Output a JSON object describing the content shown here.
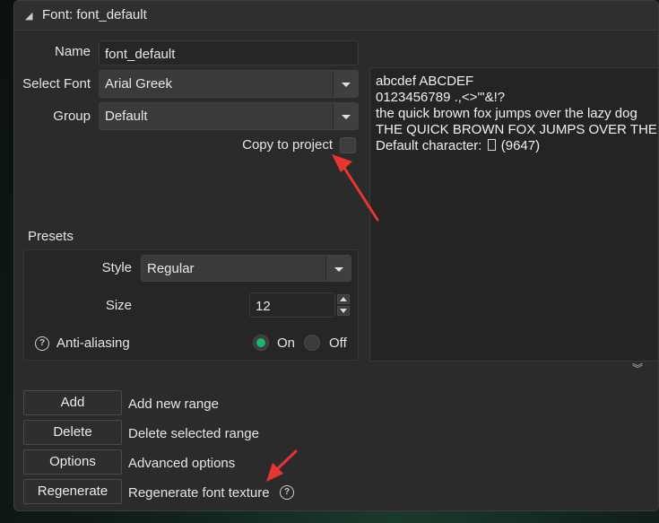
{
  "window": {
    "title": "Font: font_default"
  },
  "form": {
    "name_label": "Name",
    "name_value": "font_default",
    "select_font_label": "Select Font",
    "select_font_value": "Arial Greek",
    "group_label": "Group",
    "group_value": "Default",
    "copy_label": "Copy to project"
  },
  "preview": {
    "lines": [
      "abcdef ABCDEF",
      "0123456789 .,<>\"'&!?",
      "the quick brown fox jumps over the lazy dog",
      "THE QUICK BROWN FOX JUMPS OVER THE LAZY DOG"
    ],
    "default_char_prefix": "Default character:",
    "default_char_code": "(9647)"
  },
  "presets": {
    "title": "Presets",
    "style_label": "Style",
    "style_value": "Regular",
    "size_label": "Size",
    "size_value": "12",
    "antialias_label": "Anti-aliasing",
    "on_label": "On",
    "off_label": "Off",
    "help_glyph": "?"
  },
  "actions": [
    {
      "label": "Add",
      "desc": "Add new range"
    },
    {
      "label": "Delete",
      "desc": "Delete selected range"
    },
    {
      "label": "Options",
      "desc": "Advanced options"
    },
    {
      "label": "Regenerate",
      "desc": "Regenerate font texture"
    }
  ],
  "colors": {
    "accent_green": "#17b86a",
    "annotation_red": "#e8352f"
  }
}
